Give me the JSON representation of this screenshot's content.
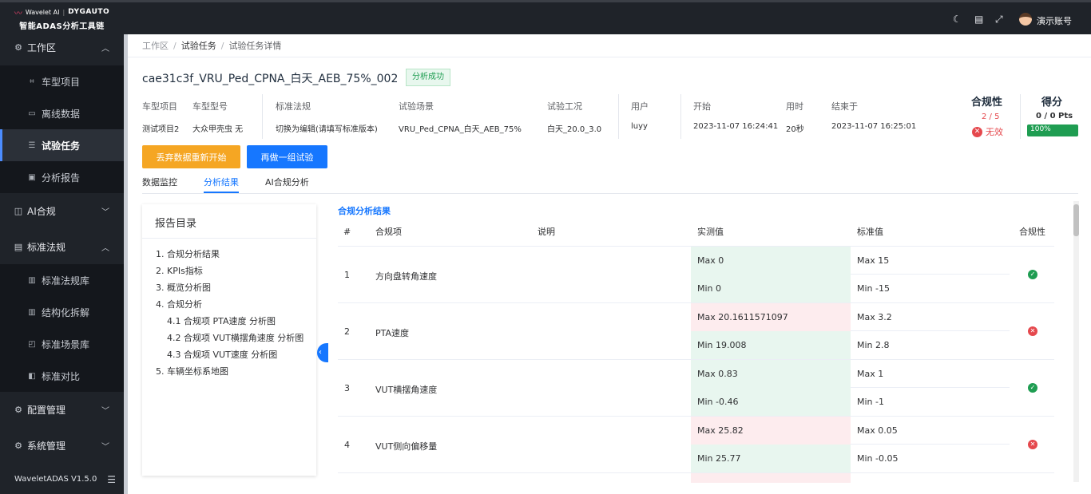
{
  "app": {
    "logo_brand": "Wavelet AI",
    "logo_partner": "DYGAUTO",
    "logo_subtitle": "智能ADAS分析工具链",
    "version": "WaveletADAS  V1.5.0"
  },
  "sidebar": {
    "groups": [
      {
        "label": "工作区",
        "icon": "gear-icon",
        "expanded": true
      },
      {
        "label": "AI合规",
        "icon": "ai-icon",
        "expanded": false
      },
      {
        "label": "标准法规",
        "icon": "document-icon",
        "expanded": true
      },
      {
        "label": "配置管理",
        "icon": "gear-icon",
        "expanded": false
      },
      {
        "label": "系统管理",
        "icon": "gear-icon",
        "expanded": false
      }
    ],
    "items": [
      {
        "label": "车型项目",
        "icon": "car-icon"
      },
      {
        "label": "离线数据",
        "icon": "folder-icon"
      },
      {
        "label": "试验任务",
        "icon": "list-icon",
        "active": true
      },
      {
        "label": "分析报告",
        "icon": "monitor-icon"
      },
      {
        "label": "标准法规库",
        "icon": "book-icon"
      },
      {
        "label": "结构化拆解",
        "icon": "book-icon"
      },
      {
        "label": "标准场景库",
        "icon": "layers-icon"
      },
      {
        "label": "标准对比",
        "icon": "compare-icon"
      }
    ]
  },
  "topbar": {
    "username": "演示账号",
    "icons": [
      "moon-icon",
      "document-icon",
      "fullscreen-icon"
    ]
  },
  "breadcrumb": [
    "工作区",
    "试验任务",
    "试验任务详情"
  ],
  "task": {
    "title": "cae31c3f_VRU_Ped_CPNA_白天_AEB_75%_002",
    "status": "分析成功",
    "status_color": "#1f9d52"
  },
  "info": {
    "headers": [
      "车型项目",
      "车型型号",
      "标准法规",
      "试验场景",
      "试验工况",
      "用户",
      "开始",
      "用时",
      "结束于"
    ],
    "values": [
      "测试项目2",
      "大众甲壳虫 无",
      "切换为编辑(请填写标准版本)",
      "VRU_Ped_CPNA_白天_AEB_75%",
      "白天_20.0_3.0",
      "luyy",
      "2023-11-07 16:24:41",
      "20秒",
      "2023-11-07 16:25:01"
    ]
  },
  "compliance": {
    "title": "合规性",
    "ratio": "2 / 5",
    "status": "无效",
    "status_color": "#e5484d"
  },
  "score": {
    "title": "得分",
    "points": "0 / 0 Pts",
    "percent_label": "100%",
    "percent": 100,
    "bar_color": "#1f9d52"
  },
  "buttons": {
    "discard": "丢弃数据重新开始",
    "redo": "再做一组试验"
  },
  "tabs": [
    "数据监控",
    "分析结果",
    "AI合规分析"
  ],
  "active_tab": "分析结果",
  "toc": {
    "title": "报告目录",
    "items": [
      "1. 合规分析结果",
      "2. KPIs指标",
      "3. 概览分析图",
      "4. 合规分析",
      "4.1 合规项 PTA速度 分析图",
      "4.2 合规项 VUT横摆角速度 分析图",
      "4.3 合规项 VUT速度 分析图",
      "5. 车辆坐标系地图"
    ]
  },
  "results": {
    "section_title": "合规分析结果",
    "headers": [
      "#",
      "合规项",
      "说明",
      "实测值",
      "标准值",
      "合规性"
    ],
    "rows": [
      {
        "num": "1",
        "name": "方向盘转角速度",
        "max": "Max 0",
        "min": "Min 0",
        "max_state": "ok",
        "min_state": "ok",
        "std_max": "Max 15",
        "std_min": "Min -15",
        "pass": true
      },
      {
        "num": "2",
        "name": "PTA速度",
        "max": "Max 20.1611571097",
        "min": "Min 19.008",
        "max_state": "bad",
        "min_state": "ok",
        "std_max": "Max 3.2",
        "std_min": "Min 2.8",
        "pass": false
      },
      {
        "num": "3",
        "name": "VUT横摆角速度",
        "max": "Max 0.83",
        "min": "Min -0.46",
        "max_state": "ok",
        "min_state": "ok",
        "std_max": "Max 1",
        "std_min": "Min -1",
        "pass": true
      },
      {
        "num": "4",
        "name": "VUT侧向偏移量",
        "max": "Max 25.82",
        "min": "Min 25.77",
        "max_state": "bad",
        "min_state": "ok",
        "std_max": "Max 0.05",
        "std_min": "Min -0.05",
        "pass": false
      }
    ]
  }
}
